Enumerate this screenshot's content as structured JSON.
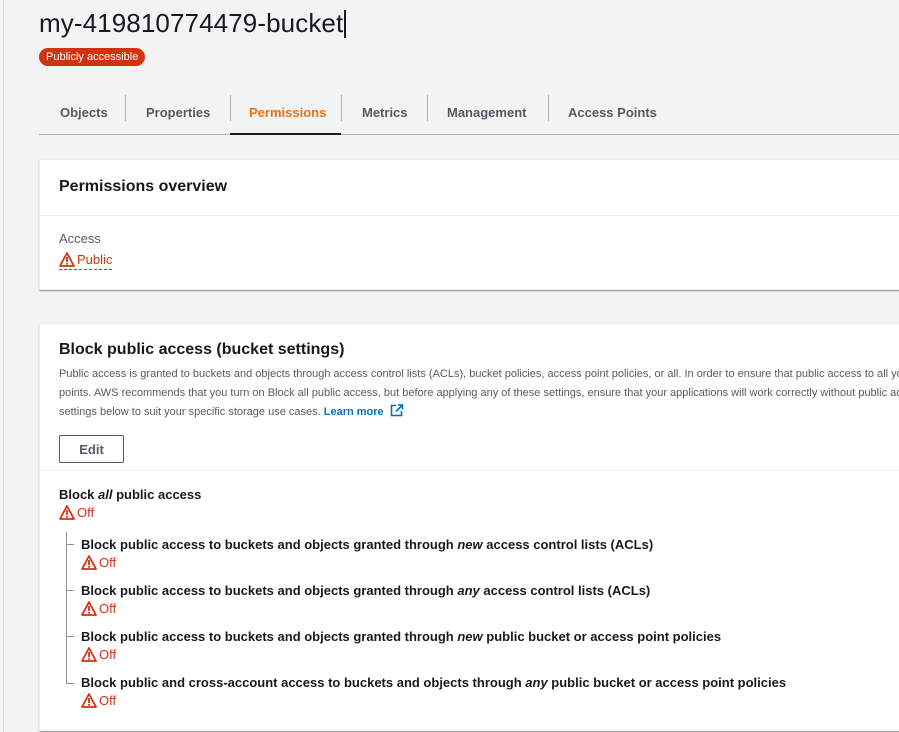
{
  "bucket": {
    "name": "my-419810774479-bucket",
    "badge": "Publicly accessible"
  },
  "tabs": [
    {
      "label": "Objects",
      "active": false
    },
    {
      "label": "Properties",
      "active": false
    },
    {
      "label": "Permissions",
      "active": true
    },
    {
      "label": "Metrics",
      "active": false
    },
    {
      "label": "Management",
      "active": false
    },
    {
      "label": "Access Points",
      "active": false
    }
  ],
  "permissions_overview": {
    "title": "Permissions overview",
    "access_label": "Access",
    "access_value": "Public"
  },
  "block_public_access": {
    "title": "Block public access (bucket settings)",
    "description_lines": [
      "Public access is granted to buckets and objects through access control lists (ACLs), bucket policies, access point policies, or all. In order to ensure that public access to all your S3 buckets and objects is blocked, turn on Block all public access. These settings apply only to this bucket and its access",
      "points. AWS recommends that you turn on Block all public access, but before applying any of these settings, ensure that your applications will work correctly without public access. If you require some level of public access to your buckets or objects within, you can customize the individual",
      "settings below to suit your specific storage use cases."
    ],
    "learn_more": "Learn more",
    "edit_button": "Edit",
    "block_all": {
      "prefix": "Block ",
      "emphasis": "all",
      "suffix": " public access",
      "value": "Off"
    },
    "settings": [
      {
        "prefix": "Block public access to buckets and objects granted through ",
        "emphasis": "new",
        "suffix": " access control lists (ACLs)",
        "value": "Off"
      },
      {
        "prefix": "Block public access to buckets and objects granted through ",
        "emphasis": "any",
        "suffix": " access control lists (ACLs)",
        "value": "Off"
      },
      {
        "prefix": "Block public access to buckets and objects granted through ",
        "emphasis": "new",
        "suffix": " public bucket or access point policies",
        "value": "Off"
      },
      {
        "prefix": "Block public and cross-account access to buckets and objects through ",
        "emphasis": "any",
        "suffix": " public bucket or access point policies",
        "value": "Off"
      }
    ]
  },
  "colors": {
    "accent": "#ec7211",
    "warning": "#d13212",
    "link": "#0073bb"
  }
}
